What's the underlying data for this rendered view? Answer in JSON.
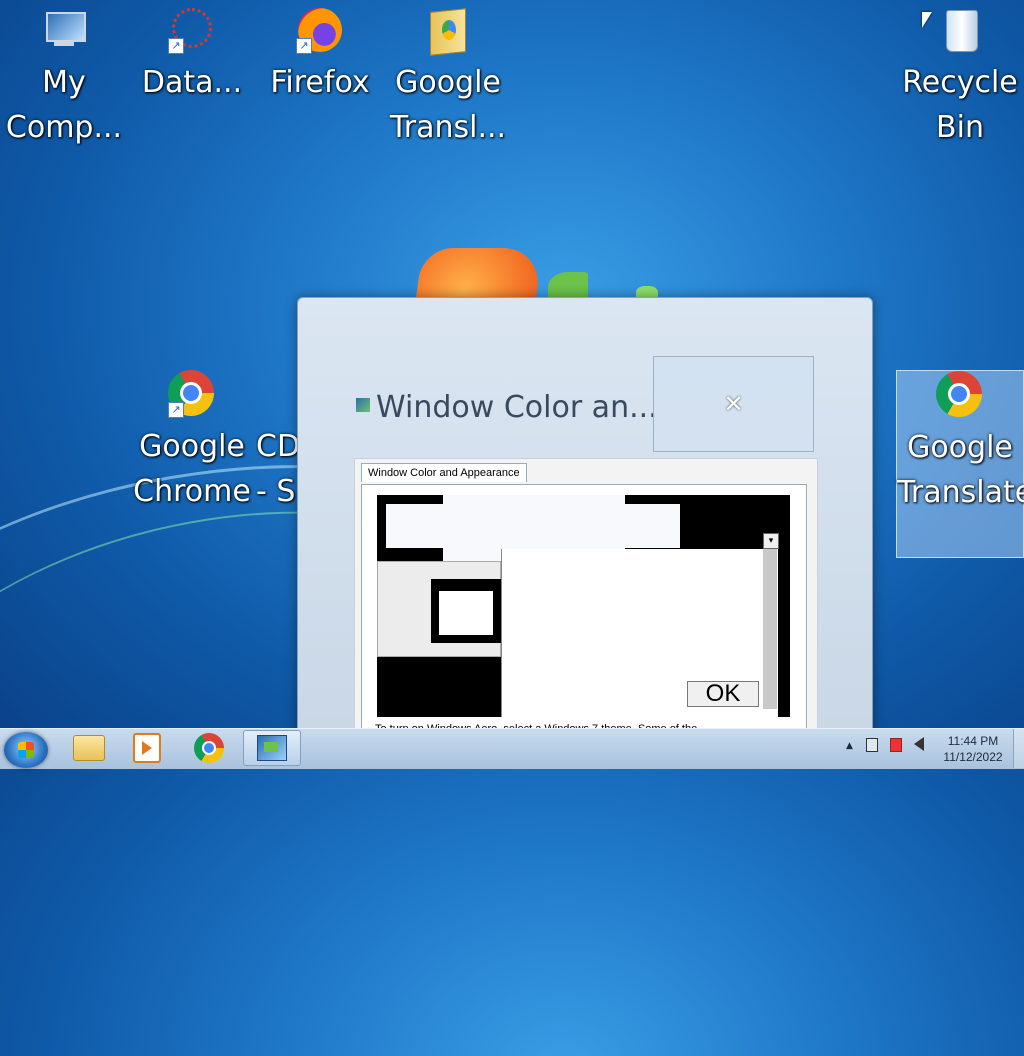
{
  "desktop": {
    "icons": [
      {
        "label": "My Comp...",
        "icon": "computer-icon"
      },
      {
        "label": "Data...",
        "icon": "data-shortcut-icon"
      },
      {
        "label": "Firefox",
        "icon": "firefox-icon"
      },
      {
        "label": "Google Transl...",
        "icon": "folder-icon"
      },
      {
        "label": "Recycle Bin",
        "icon": "recycle-bin-icon"
      },
      {
        "label": "Google Chrome",
        "icon": "chrome-icon"
      },
      {
        "label": "CD - S",
        "icon": "shortcut-icon"
      },
      {
        "label": "Google Translate",
        "icon": "chrome-icon"
      }
    ]
  },
  "window": {
    "title": "Window Color an...",
    "close_glyph": "✕",
    "tab_label": "Window Color and Appearance",
    "ok_label": "OK",
    "dropdown_glyph": "▾",
    "footer_text": "To turn on Windows Aero, select a Windows 7 theme. Some of the ..."
  },
  "taskbar": {
    "clock_time": "11:44 PM",
    "clock_date": "11/12/2022",
    "tray_chevron": "▲",
    "tray_icons": [
      "network-icon",
      "action-center-icon",
      "volume-icon"
    ]
  },
  "colors": {
    "desktop_blue": "#1f78c8",
    "taskbar": "#b9d0ea",
    "window_frame": "#dbe6f2"
  }
}
